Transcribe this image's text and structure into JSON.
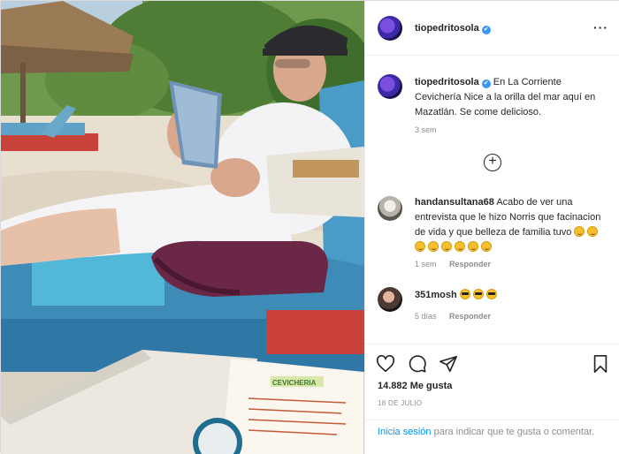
{
  "author": {
    "username": "tiopedritosola",
    "verified_mark": "✔"
  },
  "header": {
    "more_icon": "···"
  },
  "caption": {
    "username": "tiopedritosola",
    "text": "En La Corriente Cevichería Nice a la orilla del mar aquí en Mazatlán. Se come delicioso.",
    "time": "3 sem"
  },
  "load_more_icon": "+",
  "comments": [
    {
      "username": "handansultana68",
      "text": "Acabo de ver una entrevista que le hizo Norris que facinacion de vida y que belleza de familia tuvo",
      "emojis": [
        "happy",
        "happy",
        "happy",
        "happy",
        "happy",
        "happy",
        "happy",
        "happy"
      ],
      "time": "1 sem",
      "reply_label": "Responder"
    },
    {
      "username": "351mosh",
      "text": "",
      "emojis": [
        "cool",
        "cool",
        "cool"
      ],
      "time": "5 días",
      "reply_label": "Responder"
    }
  ],
  "actions": {
    "icons": [
      "heart-icon",
      "comment-icon",
      "share-icon",
      "bookmark-icon"
    ],
    "likes": "14.882 Me gusta",
    "date": "18 DE JULIO"
  },
  "login_prompt": {
    "link": "Inicia sesión",
    "text": " para indicar que te gusta o comentar."
  },
  "photo": {
    "menu_sign": "CEVICHERIA"
  },
  "colors": {
    "link_blue": "#0095f6",
    "verified_blue": "#3897f0",
    "meta_gray": "#8e8e8e"
  }
}
